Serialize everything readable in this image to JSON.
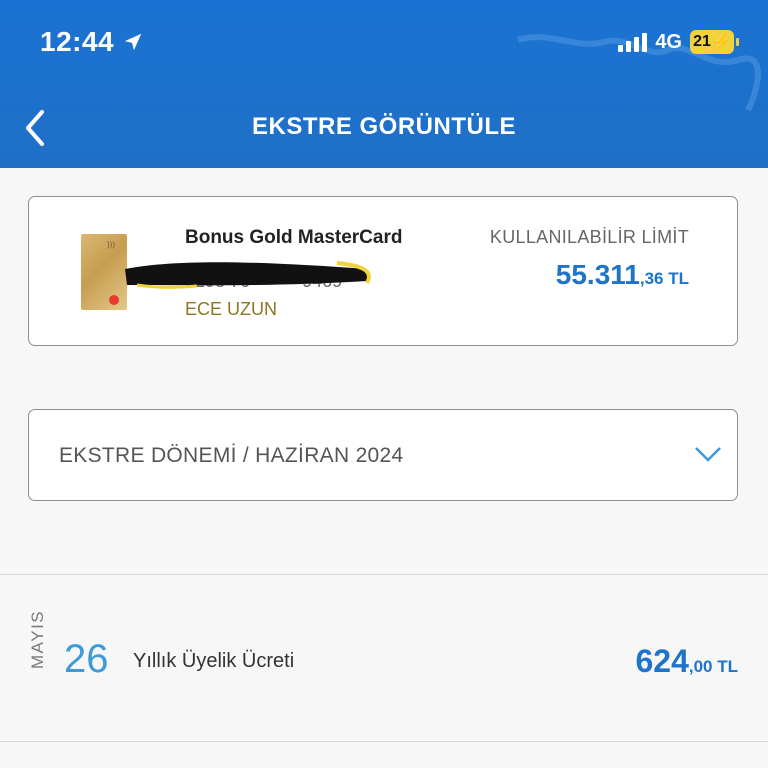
{
  "status_bar": {
    "time": "12:44",
    "network": "4G",
    "battery": "21"
  },
  "header": {
    "title": "EKSTRE GÖRÜNTÜLE"
  },
  "card": {
    "name": "Bonus Gold MasterCard",
    "number_partial": "5298 76** **** 9469",
    "owner": "ECE UZUN",
    "limit_label": "KULLANILABİLİR LİMİT",
    "limit_main": "55.311",
    "limit_decimal": ",36 TL"
  },
  "period": {
    "label": "EKSTRE DÖNEMİ / HAZİRAN 2024"
  },
  "transactions": [
    {
      "month": "MAYIS",
      "day": "26",
      "description": "Yıllık Üyelik Ücreti",
      "amount_main": "624",
      "amount_decimal": ",00 TL"
    }
  ],
  "colors": {
    "header_blue": "#1a73d2",
    "accent_blue": "#1d74c9",
    "owner_gold": "#8a7626"
  }
}
